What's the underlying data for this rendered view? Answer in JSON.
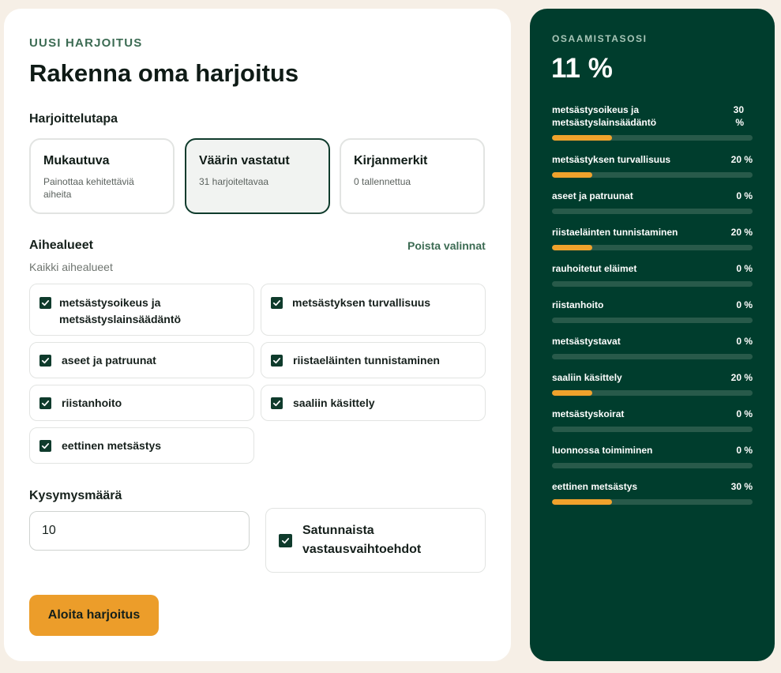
{
  "builder": {
    "eyebrow": "UUSI HARJOITUS",
    "title": "Rakenna oma harjoitus",
    "mode_label": "Harjoittelutapa",
    "modes": [
      {
        "title": "Mukautuva",
        "sub": "Painottaa kehitettäviä aiheita",
        "selected": false
      },
      {
        "title": "Väärin vastatut",
        "sub": "31 harjoiteltavaa",
        "selected": true
      },
      {
        "title": "Kirjanmerkit",
        "sub": "0 tallennettua",
        "selected": false
      }
    ],
    "topics_label": "Aihealueet",
    "clear_label": "Poista valinnat",
    "topics_sub": "Kaikki aihealueet",
    "topics": [
      {
        "label": "metsästysoikeus ja metsästyslainsäädäntö",
        "checked": true
      },
      {
        "label": "metsästyksen turvallisuus",
        "checked": true
      },
      {
        "label": "aseet ja patruunat",
        "checked": true
      },
      {
        "label": "riistaeläinten tunnistaminen",
        "checked": true
      },
      {
        "label": "riistanhoito",
        "checked": true
      },
      {
        "label": "saaliin käsittely",
        "checked": true
      },
      {
        "label": "eettinen metsästys",
        "checked": true
      }
    ],
    "count_label": "Kysymysmäärä",
    "count_value": "10",
    "shuffle_label": "Satunnaista vastausvaihtoehdot",
    "shuffle_checked": true,
    "start_label": "Aloita harjoitus"
  },
  "proficiency": {
    "eyebrow": "OSAAMISTASOSI",
    "score": "11 %",
    "skills": [
      {
        "name": "metsästysoikeus ja metsästyslainsäädäntö",
        "pct_text": "30 %",
        "value": 30
      },
      {
        "name": "metsästyksen turvallisuus",
        "pct_text": "20 %",
        "value": 20
      },
      {
        "name": "aseet ja patruunat",
        "pct_text": "0 %",
        "value": 0
      },
      {
        "name": "riistaeläinten tunnistaminen",
        "pct_text": "20 %",
        "value": 20
      },
      {
        "name": "rauhoitetut eläimet",
        "pct_text": "0 %",
        "value": 0
      },
      {
        "name": "riistanhoito",
        "pct_text": "0 %",
        "value": 0
      },
      {
        "name": "metsästystavat",
        "pct_text": "0 %",
        "value": 0
      },
      {
        "name": "saaliin käsittely",
        "pct_text": "20 %",
        "value": 20
      },
      {
        "name": "metsästyskoirat",
        "pct_text": "0 %",
        "value": 0
      },
      {
        "name": "luonnossa toimiminen",
        "pct_text": "0 %",
        "value": 0
      },
      {
        "name": "eettinen metsästys",
        "pct_text": "30 %",
        "value": 30
      }
    ]
  },
  "colors": {
    "accent": "#ec9d2a",
    "brand_dark": "#003d2d",
    "label_green": "#3c6b53"
  },
  "icons": {
    "checkbox": "checkmark-icon"
  }
}
